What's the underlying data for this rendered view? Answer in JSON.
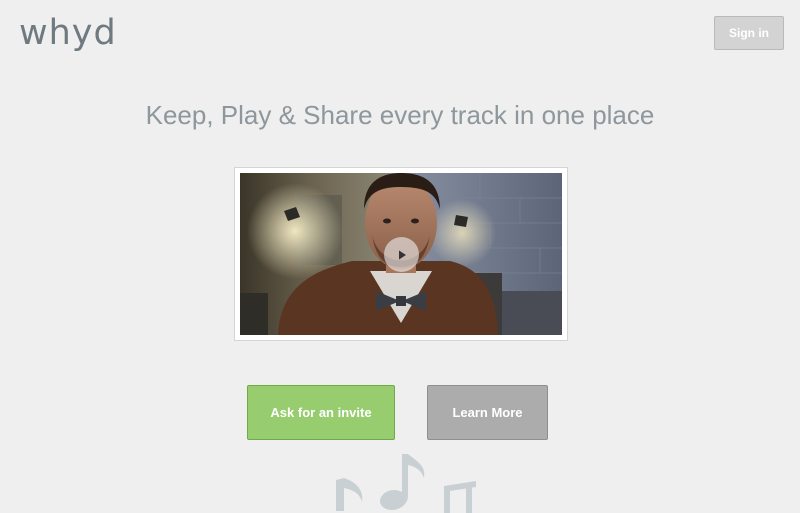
{
  "header": {
    "logo_text": "whyd",
    "signin_label": "Sign in"
  },
  "hero": {
    "headline": "Keep, Play & Share every track in one place"
  },
  "video": {
    "play_icon": "play-icon"
  },
  "actions": {
    "invite_label": "Ask for an invite",
    "learn_label": "Learn More"
  },
  "decoration": {
    "icon": "music-notes-icon"
  },
  "colors": {
    "background": "#efefef",
    "logo": "#6f7a80",
    "invite_green": "#97cd6f",
    "learn_gray": "#acacac",
    "signin_gray": "#d3d3d3"
  }
}
